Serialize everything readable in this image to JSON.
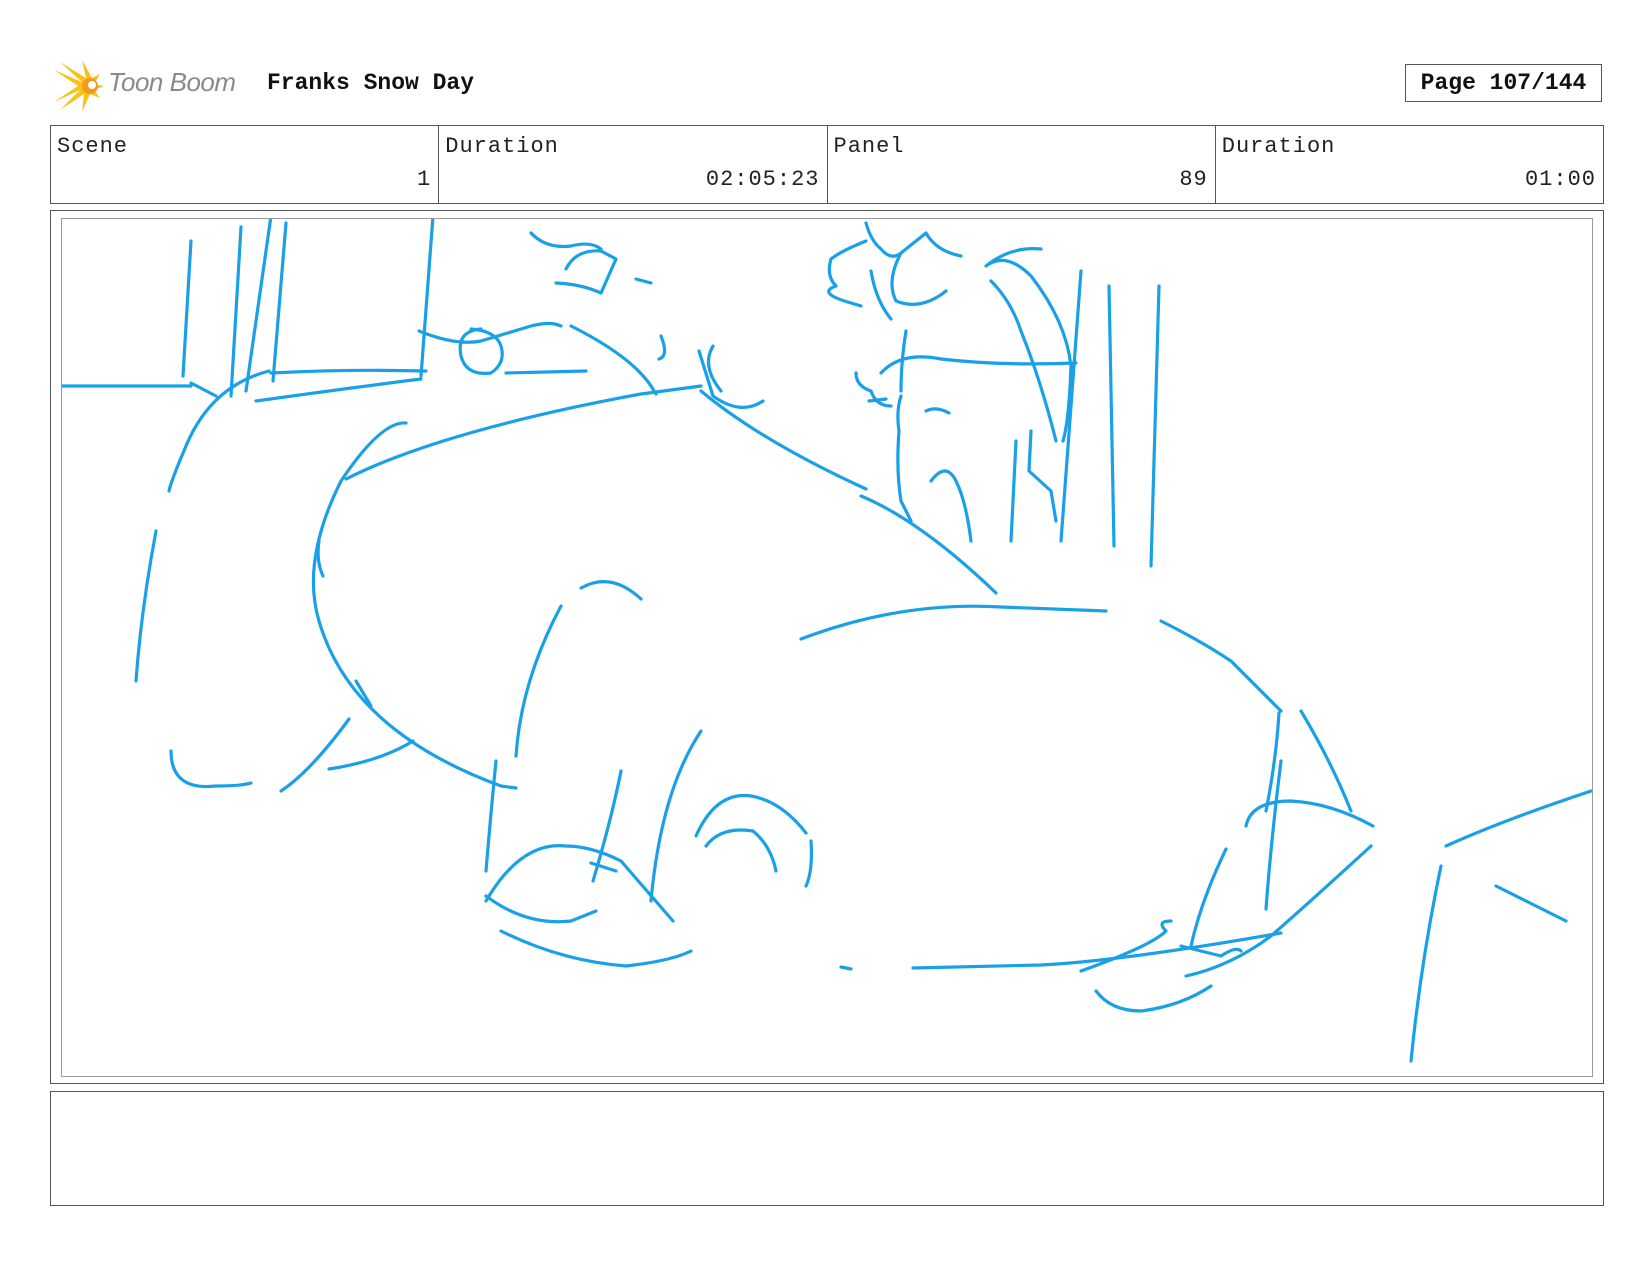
{
  "header": {
    "logo_text": "Toon Boom",
    "logo_icon": "starburst-logo-icon",
    "project_title": "Franks Snow Day",
    "page_label": "Page 107/144"
  },
  "info": {
    "scene_label": "Scene",
    "scene_value": "1",
    "scene_duration_label": "Duration",
    "scene_duration_value": "02:05:23",
    "panel_label": "Panel",
    "panel_value": "89",
    "panel_duration_label": "Duration",
    "panel_duration_value": "01:00"
  },
  "notes": {
    "text": ""
  },
  "colors": {
    "sketch": "#1aa0e6",
    "logo_yellow": "#f7c21b",
    "logo_orange": "#f39a1e",
    "border": "#555555"
  }
}
